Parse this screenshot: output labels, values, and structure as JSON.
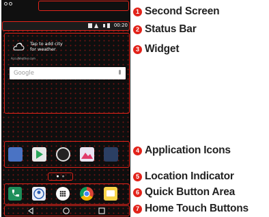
{
  "phone": {
    "status_bar": {
      "time": "00:20"
    },
    "widget": {
      "weather_line1": "Tap to add city",
      "weather_line2": "for weather",
      "weather_small": "AccuWeather.com"
    },
    "search": {
      "placeholder": "Google"
    },
    "app_icons": [
      "contacts-app-icon",
      "play-store-icon",
      "camera-icon",
      "gallery-icon",
      "apps-folder-icon"
    ],
    "quick_buttons": [
      "phone-icon",
      "contacts-icon",
      "apps-icon",
      "chrome-icon",
      "messaging-icon"
    ],
    "nav_buttons": [
      "back-button",
      "home-button",
      "recents-button"
    ]
  },
  "callouts": [
    {
      "number": "1",
      "label": "Second Screen"
    },
    {
      "number": "2",
      "label": "Status Bar"
    },
    {
      "number": "3",
      "label": "Widget"
    },
    {
      "number": "4",
      "label": "Application Icons"
    },
    {
      "number": "5",
      "label": "Location Indicator"
    },
    {
      "number": "6",
      "label": "Quick Button Area"
    },
    {
      "number": "7",
      "label": "Home Touch Buttons"
    }
  ],
  "colors": {
    "accent": "#e2231a",
    "screen_bg": "#0e0e0e"
  }
}
